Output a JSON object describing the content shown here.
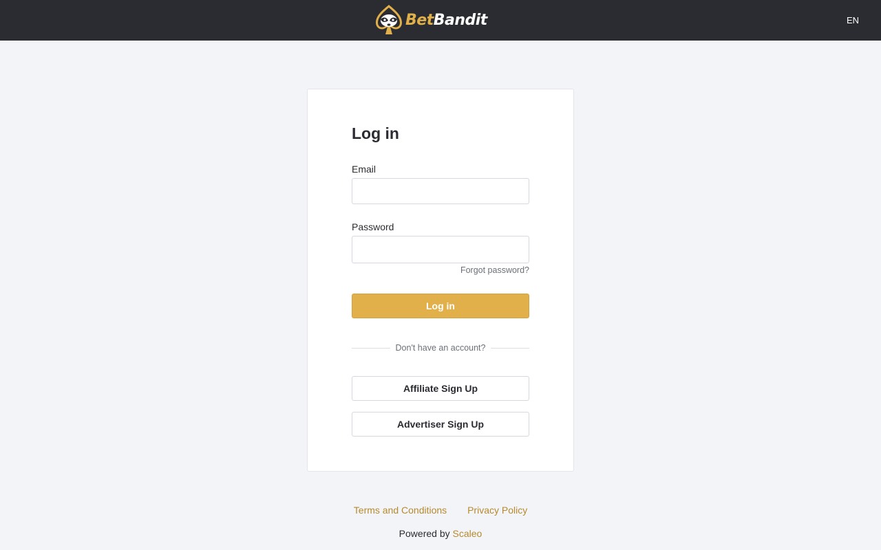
{
  "header": {
    "brand_part1": "Bet",
    "brand_part2": "Bandit",
    "language": "EN",
    "logo_icon": "raccoon-spade-icon"
  },
  "login": {
    "title": "Log in",
    "email_label": "Email",
    "email_value": "",
    "password_label": "Password",
    "password_value": "",
    "forgot_password": "Forgot password?",
    "submit_label": "Log in",
    "no_account_text": "Don't have an account?",
    "affiliate_signup": "Affiliate Sign Up",
    "advertiser_signup": "Advertiser Sign Up"
  },
  "footer": {
    "terms": "Terms and Conditions",
    "privacy": "Privacy Policy",
    "powered_by": "Powered by",
    "powered_brand": "Scaleo"
  },
  "colors": {
    "header_bg": "#2b2c31",
    "page_bg": "#f3f4f8",
    "accent": "#e1b04a",
    "link": "#b68a2c"
  }
}
